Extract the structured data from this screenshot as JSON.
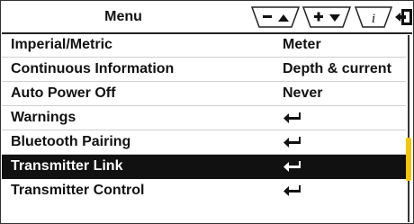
{
  "header": {
    "title": "Menu",
    "buttons": [
      {
        "icon": "minus-up-icon"
      },
      {
        "icon": "plus-down-icon"
      },
      {
        "icon": "info-icon"
      },
      {
        "icon": "exit-icon"
      }
    ]
  },
  "rows": [
    {
      "label": "Imperial/Metric",
      "value": "Meter",
      "selected": false
    },
    {
      "label": "Continuous Information",
      "value": "Depth & current",
      "selected": false
    },
    {
      "label": "Auto Power Off",
      "value": "Never",
      "selected": false
    },
    {
      "label": "Warnings",
      "value_icon": "enter-arrow-icon",
      "selected": false
    },
    {
      "label": "Bluetooth Pairing",
      "value_icon": "enter-arrow-icon",
      "selected": false
    },
    {
      "label": "Transmitter Link",
      "value_icon": "enter-arrow-icon",
      "selected": true
    },
    {
      "label": "Transmitter Control",
      "value_icon": "enter-arrow-icon",
      "selected": false
    }
  ],
  "scrollbar": {
    "accent_color": "#f3c600",
    "position_fraction": 0.55
  }
}
